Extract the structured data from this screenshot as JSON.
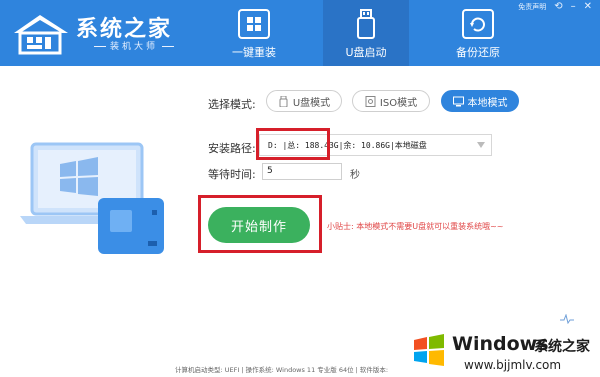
{
  "app": {
    "title": "系统之家",
    "subtitle": "装机大师"
  },
  "top_links": {
    "disclaimer": "免责声明"
  },
  "tabs": [
    {
      "label": "一键重装",
      "icon": "windows-window-icon"
    },
    {
      "label": "U盘启动",
      "icon": "usb-drive-icon"
    },
    {
      "label": "备份还原",
      "icon": "backup-restore-icon"
    }
  ],
  "active_tab": "U盘启动",
  "mode": {
    "label": "选择模式:",
    "options": [
      {
        "label": "U盘模式",
        "icon": "usb-icon"
      },
      {
        "label": "ISO模式",
        "icon": "disc-file-icon"
      },
      {
        "label": "本地模式",
        "icon": "monitor-icon"
      }
    ],
    "selected": "本地模式"
  },
  "install_path": {
    "label": "安装路径:",
    "value": "D: |总: 188.43G|余: 10.86G|本地磁盘"
  },
  "wait_time": {
    "label": "等待时间:",
    "value": "5",
    "unit": "秒"
  },
  "start_button": "开始制作",
  "tip": "小贴士: 本地模式不需要U盘就可以重装系统哦~~",
  "footer": "计算机启动类型: UEFI | 操作系统: Windows 11 专业版 64位 | 软件版本:",
  "watermark": {
    "brand": "Windows",
    "brand_cn": "系统之家",
    "url": "www.bjjmlv.com"
  },
  "colors": {
    "header": "#2f84dd",
    "active_tab": "#2a73c6",
    "start_button": "#3bb15e",
    "tip": "#e04545",
    "highlight_box": "#d61f2a"
  }
}
